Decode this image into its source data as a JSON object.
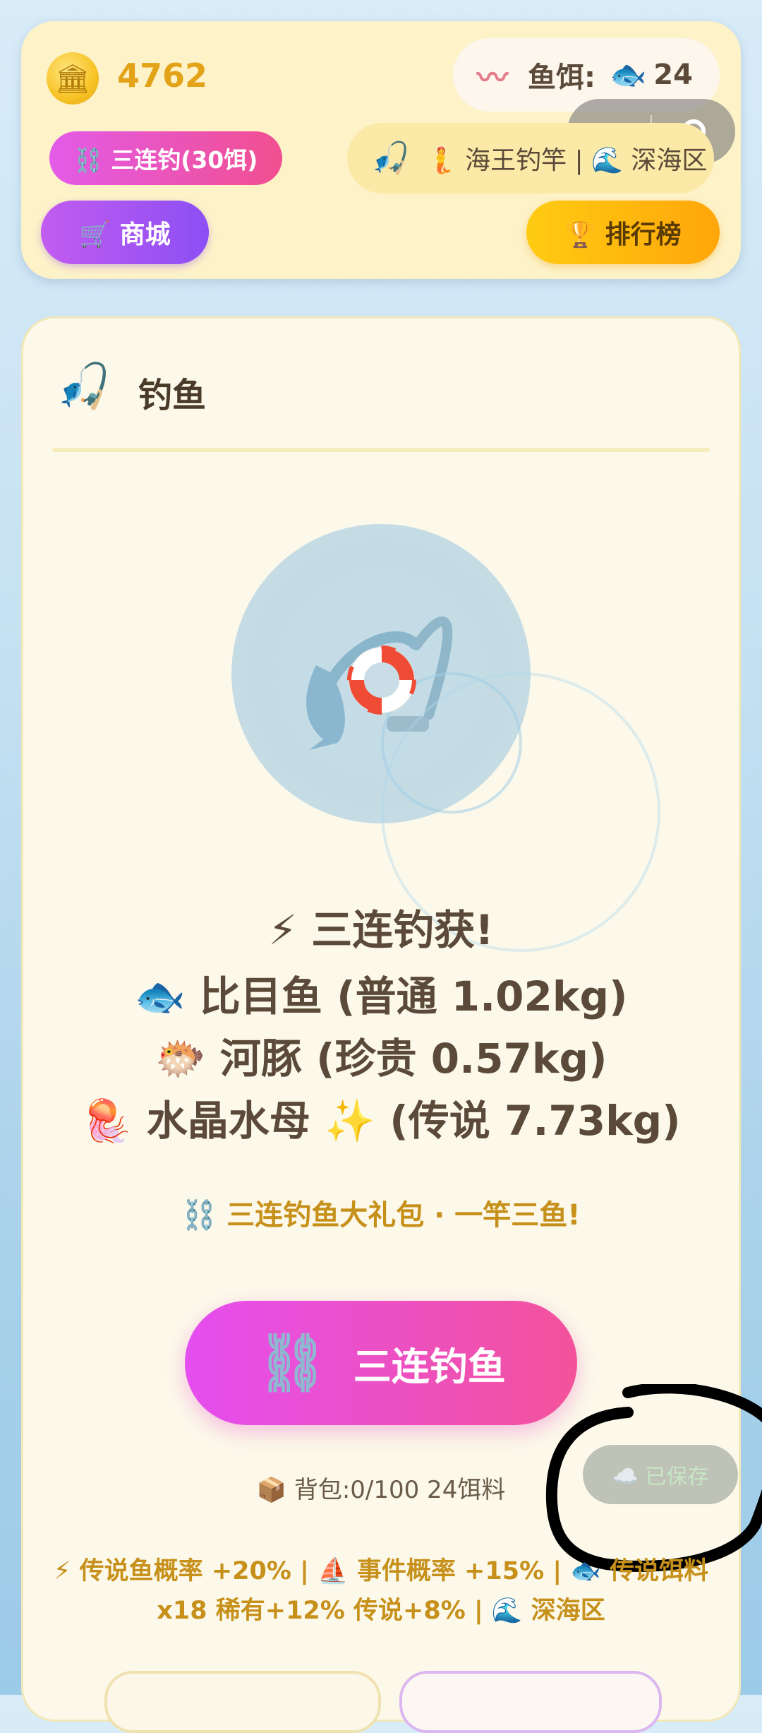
{
  "header": {
    "coins": "4762",
    "bait_label": "鱼饵:",
    "bait_count": "24",
    "triple_pill": "⛓️ 三连钓(30饵)",
    "rod_info": "🧜 海王钓竿 | 🌊 深海区",
    "shop_label": "🛒 商城",
    "ranking_label": "🏆 排行榜"
  },
  "card": {
    "title": "钓鱼",
    "result_title": "⚡ 三连钓获!",
    "results": [
      "🐟 比目鱼 (普通 1.02kg)",
      "🐡 河豚 (珍贵 0.57kg)",
      "🪼 水晶水母 ✨ (传说 7.73kg)"
    ],
    "promo": "⛓️ 三连钓鱼大礼包 · 一竿三鱼!",
    "main_button": "三连钓鱼",
    "backpack": "📦 背包:0/100 24饵料",
    "saved": "☁️ 已保存",
    "bonus_line1": "⚡ 传说鱼概率 +20% | ⛵ 事件概率 +15% | 🐟 传说饵料",
    "bonus_line2": "x18 稀有+12% 传说+8% | 🌊 深海区"
  },
  "icons": {
    "coin": "bank-coin-icon",
    "bait": "worm-icon",
    "fish": "fish-icon",
    "rod": "fishing-rod-icon",
    "lifebuoy": "lifebuoy-icon",
    "chain": "chain-icon",
    "more": "more-dots-icon",
    "close": "target-close-icon"
  },
  "colors": {
    "coin_text": "#e3a319",
    "triple_gradient_start": "#e54ef0",
    "triple_gradient_end": "#f3529a",
    "shop_gradient": "#8c4ff4",
    "ranking_gradient": "#ffa60a",
    "promo_text": "#c6901a",
    "card_bg": "#fcf9ea"
  }
}
